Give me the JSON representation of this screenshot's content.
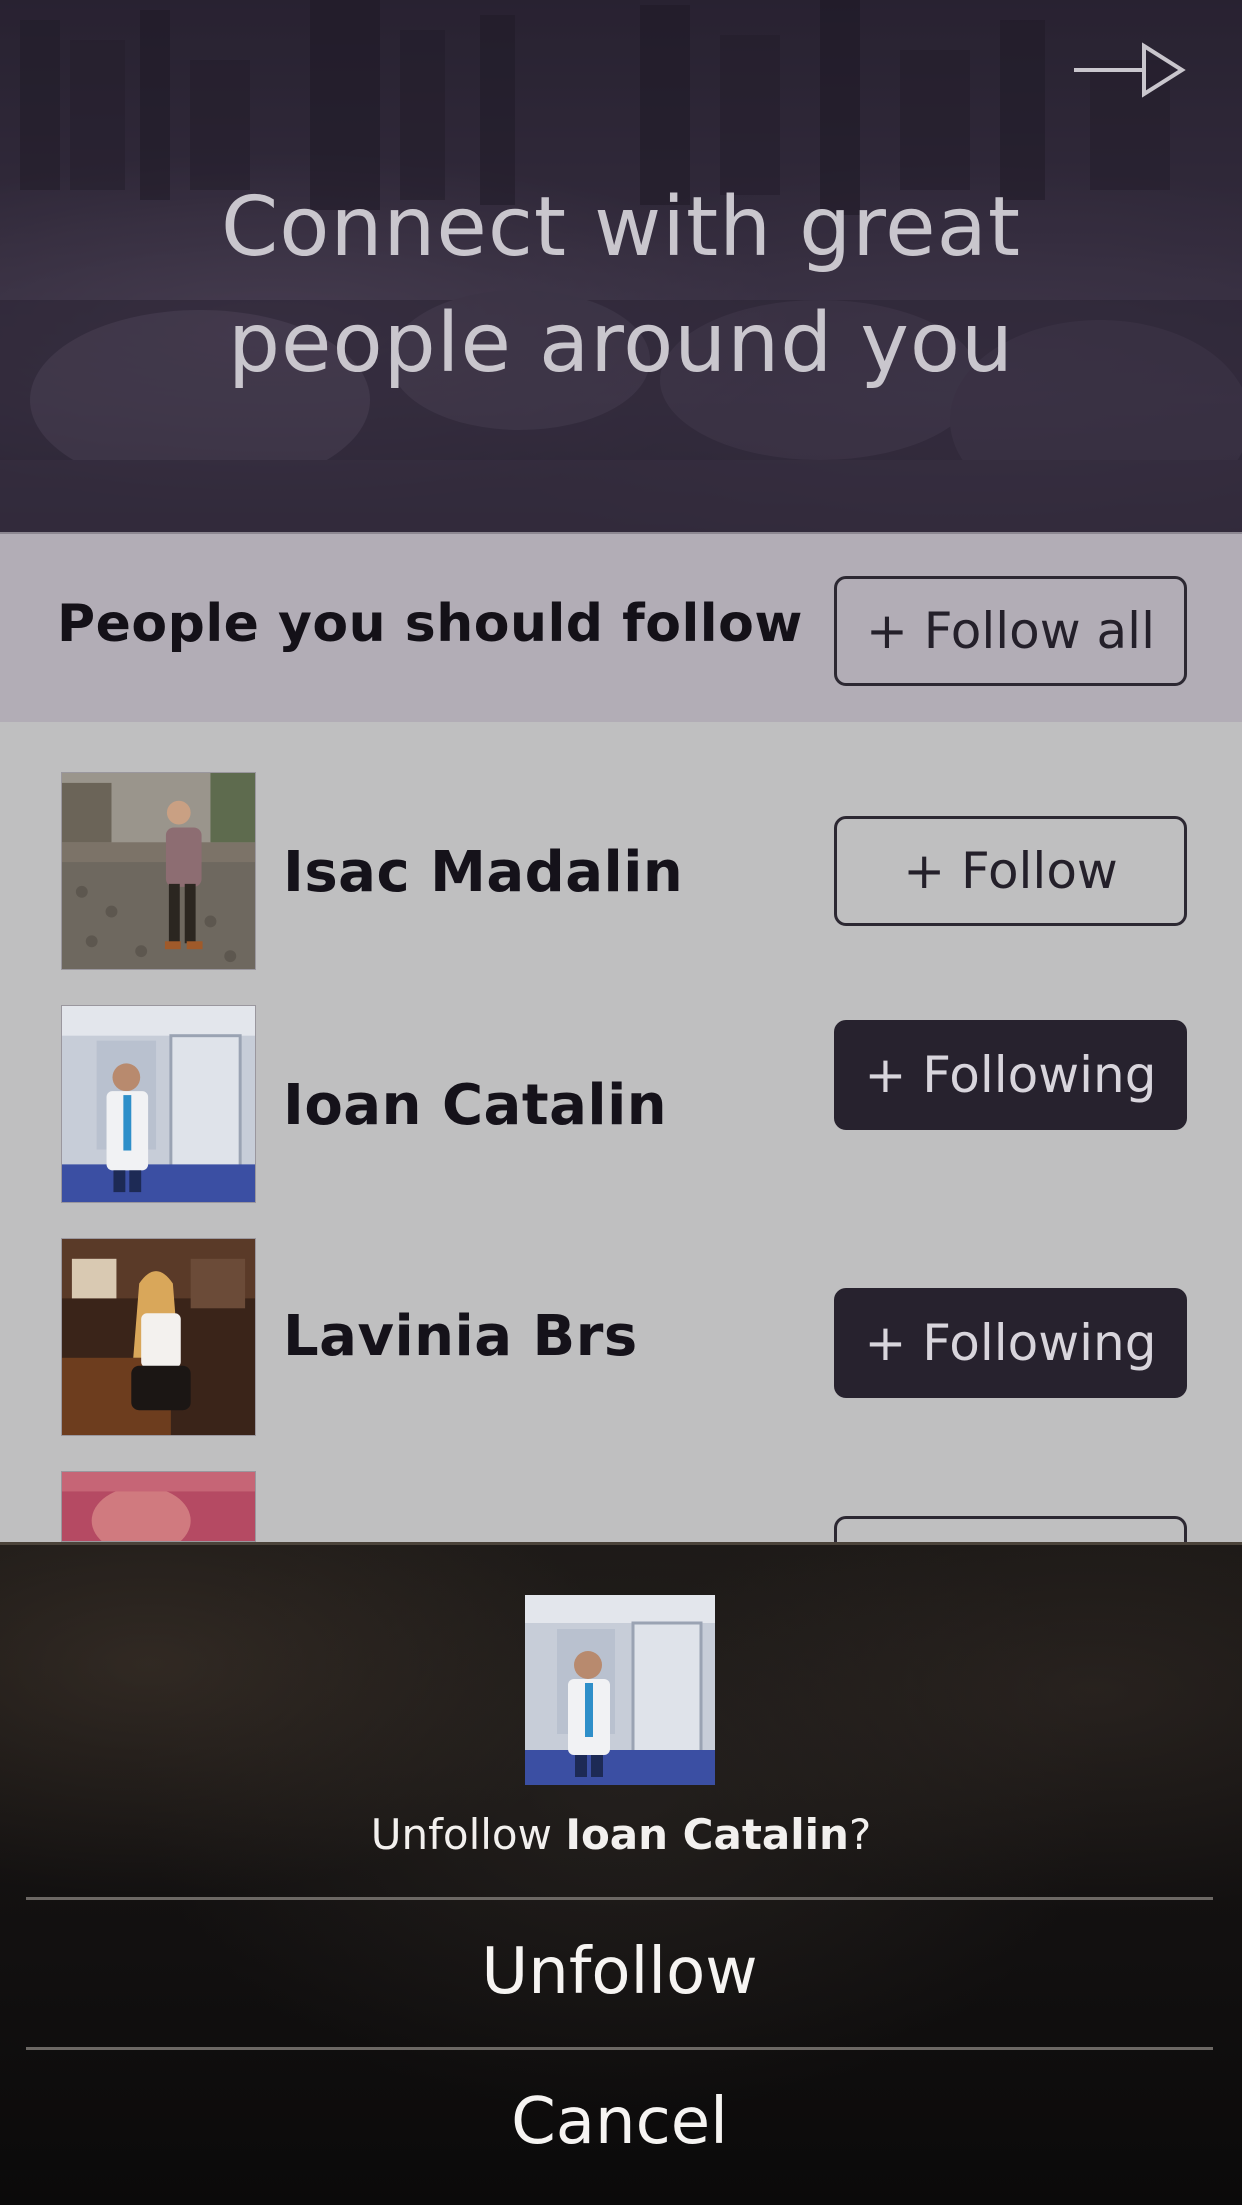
{
  "hero": {
    "title_line1": "Connect with great",
    "title_line2": "people around you",
    "next_icon": "arrow-right-icon"
  },
  "suggestions": {
    "header_title": "People you should follow",
    "follow_all_label": "+ Follow all",
    "people": [
      {
        "name": "Isac Madalin",
        "button_label": "+ Follow",
        "state": "not-following"
      },
      {
        "name": "Ioan Catalin",
        "button_label": "+ Following",
        "state": "following"
      },
      {
        "name": "Lavinia Brs",
        "button_label": "+ Following",
        "state": "following"
      }
    ]
  },
  "action_sheet": {
    "message_prefix": "Unfollow ",
    "message_name": "Ioan Catalin",
    "message_suffix": "?",
    "unfollow_label": "Unfollow",
    "cancel_label": "Cancel"
  },
  "colors": {
    "hero_bg": "#3c3446",
    "header_bar": "#b2adb6",
    "list_bg": "#bfbfc0",
    "button_dark": "#27222e",
    "sheet_bg": "#121010"
  }
}
